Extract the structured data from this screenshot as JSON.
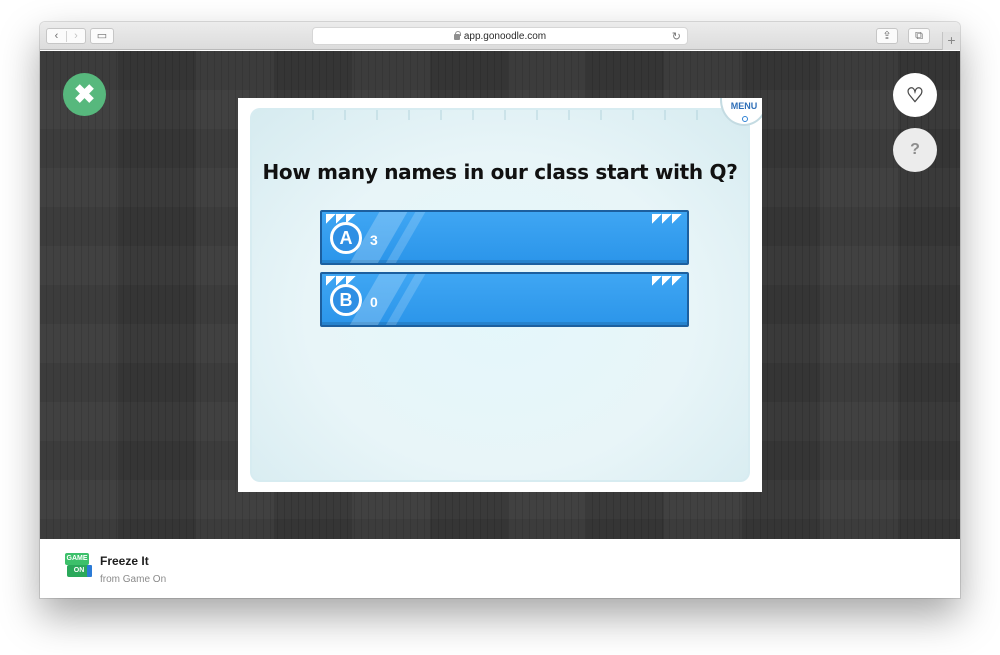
{
  "browser": {
    "address": "app.gonoodle.com",
    "back_glyph": "‹",
    "forward_glyph": "›",
    "sidebar_glyph": "▭",
    "share_glyph": "⇪",
    "tabs_glyph": "⧉",
    "new_tab_glyph": "+",
    "reload_glyph": "↻"
  },
  "stage": {
    "close_glyph": "✖",
    "favorite_glyph": "♡",
    "help_label": "?"
  },
  "game": {
    "menu_label": "MENU",
    "question": "How many names in our class start with Q?",
    "answers": [
      {
        "letter": "A",
        "text": "3"
      },
      {
        "letter": "B",
        "text": "0"
      }
    ]
  },
  "footer": {
    "logo_top": "GAME",
    "logo_bottom": "ON",
    "title": "Freeze It",
    "subtitle": "from Game On"
  },
  "colors": {
    "close_green": "#57b87d",
    "answer_blue": "#3fa6f3",
    "answer_border": "#1c5f9f",
    "menu_text": "#2f6fb8"
  }
}
